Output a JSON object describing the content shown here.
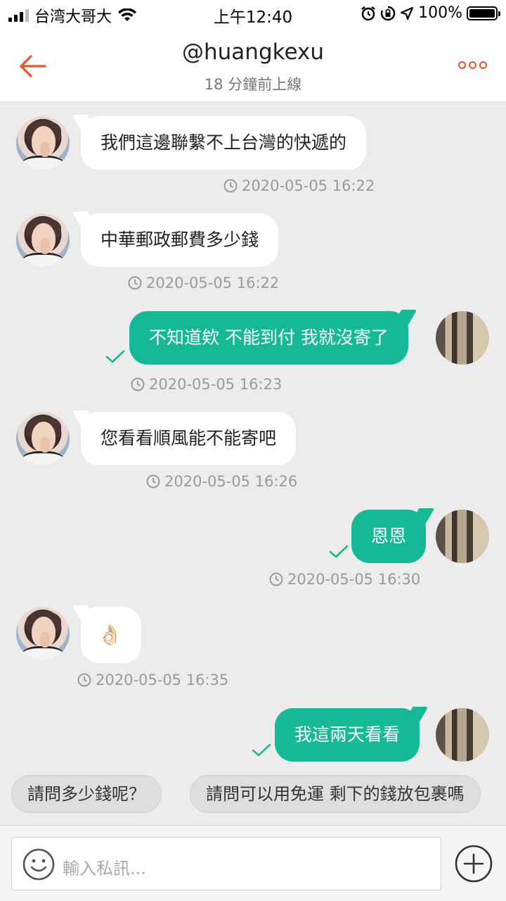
{
  "status_bar": {
    "carrier": "台湾大哥大",
    "time": "上午12:40",
    "battery": "100%",
    "battery_level": 1.0,
    "signal_bars_active": 3,
    "signal_bars_total": 4
  },
  "header": {
    "title": "@huangkexu",
    "subtitle": "18 分鐘前上線",
    "accent_color": "#e8542b"
  },
  "messages": [
    {
      "sender": "them",
      "text": "我們這邊聯繫不上台灣的快遞的",
      "time": "2020-05-05 16:22"
    },
    {
      "sender": "them",
      "text": "中華郵政郵費多少錢",
      "time": "2020-05-05 16:22"
    },
    {
      "sender": "me",
      "text": "不知道欸 不能到付 我就沒寄了",
      "time": "2020-05-05 16:23"
    },
    {
      "sender": "them",
      "text": "您看看順風能不能寄吧",
      "time": "2020-05-05 16:26"
    },
    {
      "sender": "me",
      "text": "恩恩",
      "time": "2020-05-05 16:30"
    },
    {
      "sender": "them",
      "text": "👌🏻",
      "time": "2020-05-05 16:35"
    },
    {
      "sender": "me",
      "text": "我這兩天看看",
      "time": ""
    }
  ],
  "quick_replies": [
    "請問多少錢呢？",
    "請問可以用免運 剩下的錢放包裹嗎"
  ],
  "input": {
    "placeholder": "輸入私訊..."
  },
  "colors": {
    "sent_bubble": "#16b996",
    "received_bubble": "#ffffff",
    "background": "#ececec"
  }
}
